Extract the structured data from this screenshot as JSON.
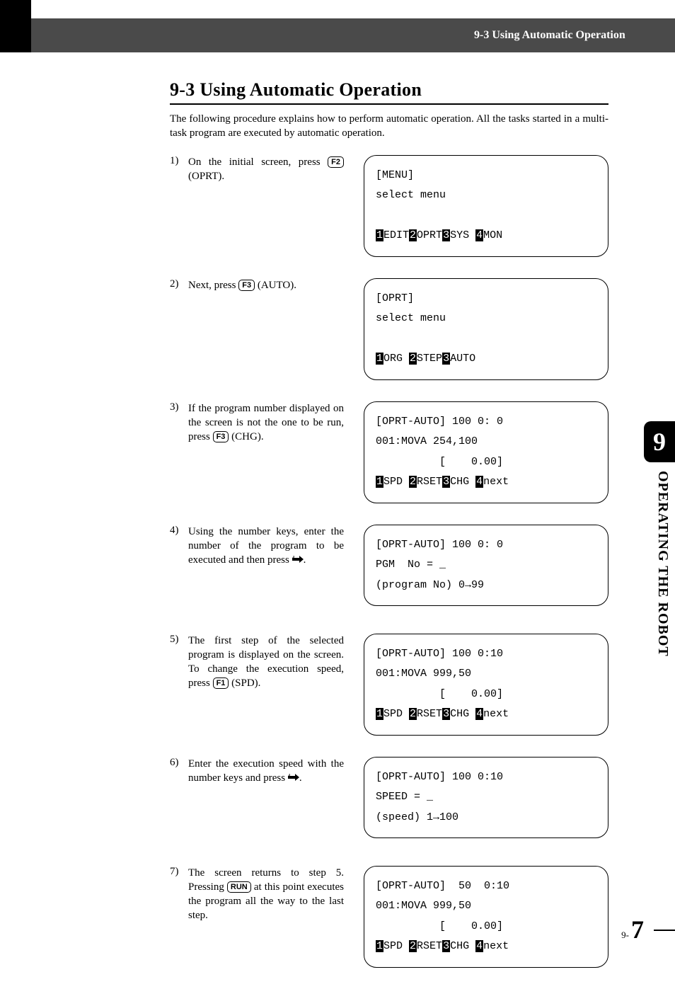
{
  "header": {
    "bar_text": "9-3 Using Automatic Operation"
  },
  "section": {
    "title": "9-3   Using Automatic Operation",
    "intro": "The following procedure explains how to perform automatic operation. All the tasks started in a multi-task program are executed by automatic operation."
  },
  "steps": [
    {
      "num": "1)",
      "pre": "On the initial screen, press ",
      "key": "F2",
      "post": " (OPRT).",
      "lcd": [
        {
          "t": "[MENU]"
        },
        {
          "t": "select menu"
        },
        {
          "t": ""
        },
        {
          "runs": [
            {
              "inv": true,
              "t": "1"
            },
            {
              "t": "EDIT"
            },
            {
              "inv": true,
              "t": "2"
            },
            {
              "t": "OPRT"
            },
            {
              "inv": true,
              "t": "3"
            },
            {
              "t": "SYS "
            },
            {
              "inv": true,
              "t": "4"
            },
            {
              "t": "MON"
            }
          ]
        }
      ]
    },
    {
      "num": "2)",
      "pre": "Next, press ",
      "key": "F3",
      "post": " (AUTO).",
      "lcd": [
        {
          "t": "[OPRT]"
        },
        {
          "t": "select menu"
        },
        {
          "t": ""
        },
        {
          "runs": [
            {
              "inv": true,
              "t": "1"
            },
            {
              "t": "ORG "
            },
            {
              "inv": true,
              "t": "2"
            },
            {
              "t": "STEP"
            },
            {
              "inv": true,
              "t": "3"
            },
            {
              "t": "AUTO"
            }
          ]
        }
      ]
    },
    {
      "num": "3)",
      "pre": "If the program number displayed on the screen is not the one to be run, press ",
      "key": "F3",
      "post": " (CHG).",
      "lcd": [
        {
          "t": "[OPRT-AUTO] 100 0: 0"
        },
        {
          "t": "001:MOVA 254,100"
        },
        {
          "t": "          [    0.00]"
        },
        {
          "runs": [
            {
              "inv": true,
              "t": "1"
            },
            {
              "t": "SPD "
            },
            {
              "inv": true,
              "t": "2"
            },
            {
              "t": "RSET"
            },
            {
              "inv": true,
              "t": "3"
            },
            {
              "t": "CHG "
            },
            {
              "inv": true,
              "t": "4"
            },
            {
              "t": "next"
            }
          ]
        }
      ]
    },
    {
      "num": "4)",
      "pre": "Using the number keys, enter the number of the program to be executed and then press ",
      "arrow": true,
      "post": ".",
      "lcd": [
        {
          "t": "[OPRT-AUTO] 100 0: 0"
        },
        {
          "t": "PGM  No = _"
        },
        {
          "t": "(program No) 0→99"
        },
        {
          "t": ""
        }
      ]
    },
    {
      "num": "5)",
      "pre": "The first step of the selected program is displayed on the screen. To change the execution speed, press ",
      "key": "F1",
      "post": " (SPD).",
      "lcd": [
        {
          "t": "[OPRT-AUTO] 100 0:10"
        },
        {
          "t": "001:MOVA 999,50"
        },
        {
          "t": "          [    0.00]"
        },
        {
          "runs": [
            {
              "inv": true,
              "t": "1"
            },
            {
              "t": "SPD "
            },
            {
              "inv": true,
              "t": "2"
            },
            {
              "t": "RSET"
            },
            {
              "inv": true,
              "t": "3"
            },
            {
              "t": "CHG "
            },
            {
              "inv": true,
              "t": "4"
            },
            {
              "t": "next"
            }
          ]
        }
      ]
    },
    {
      "num": "6)",
      "pre": "Enter the execution speed with the number keys and press ",
      "arrow": true,
      "post": ".",
      "lcd": [
        {
          "t": "[OPRT-AUTO] 100 0:10"
        },
        {
          "t": "SPEED = _"
        },
        {
          "t": "(speed) 1→100"
        },
        {
          "t": ""
        }
      ]
    },
    {
      "num": "7)",
      "pre": "The screen returns to step 5. Pressing ",
      "key": "RUN",
      "post": " at this point executes the program all the way to the last step.",
      "lcd": [
        {
          "t": "[OPRT-AUTO]  50  0:10"
        },
        {
          "t": "001:MOVA 999,50"
        },
        {
          "t": "          [    0.00]"
        },
        {
          "runs": [
            {
              "inv": true,
              "t": "1"
            },
            {
              "t": "SPD "
            },
            {
              "inv": true,
              "t": "2"
            },
            {
              "t": "RSET"
            },
            {
              "inv": true,
              "t": "3"
            },
            {
              "t": "CHG "
            },
            {
              "inv": true,
              "t": "4"
            },
            {
              "t": "next"
            }
          ]
        }
      ]
    }
  ],
  "sidebar": {
    "chapter_num": "9",
    "chapter_label": "OPERATING THE ROBOT"
  },
  "page": {
    "prefix": "9-",
    "num": "7"
  }
}
